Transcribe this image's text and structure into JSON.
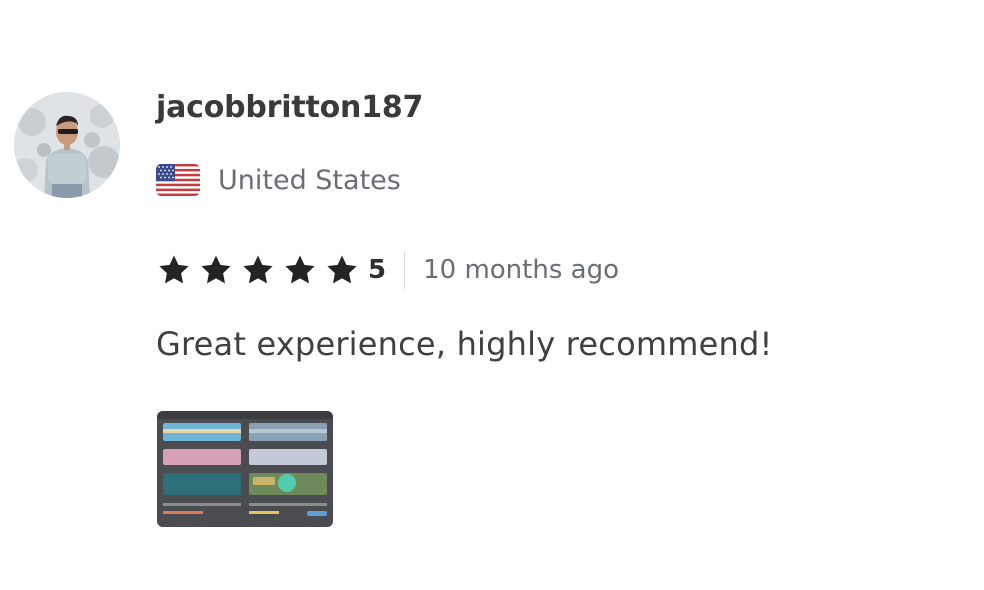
{
  "review": {
    "username": "jacobbritton187",
    "country": "United States",
    "flag_icon": "us-flag-icon",
    "rating": {
      "value": "5",
      "stars": 5,
      "max_stars": 5,
      "star_color": "#222325"
    },
    "time_ago": "10 months ago",
    "text": "Great experience, highly recommend!",
    "attachment_icon": "image-thumbnail"
  }
}
